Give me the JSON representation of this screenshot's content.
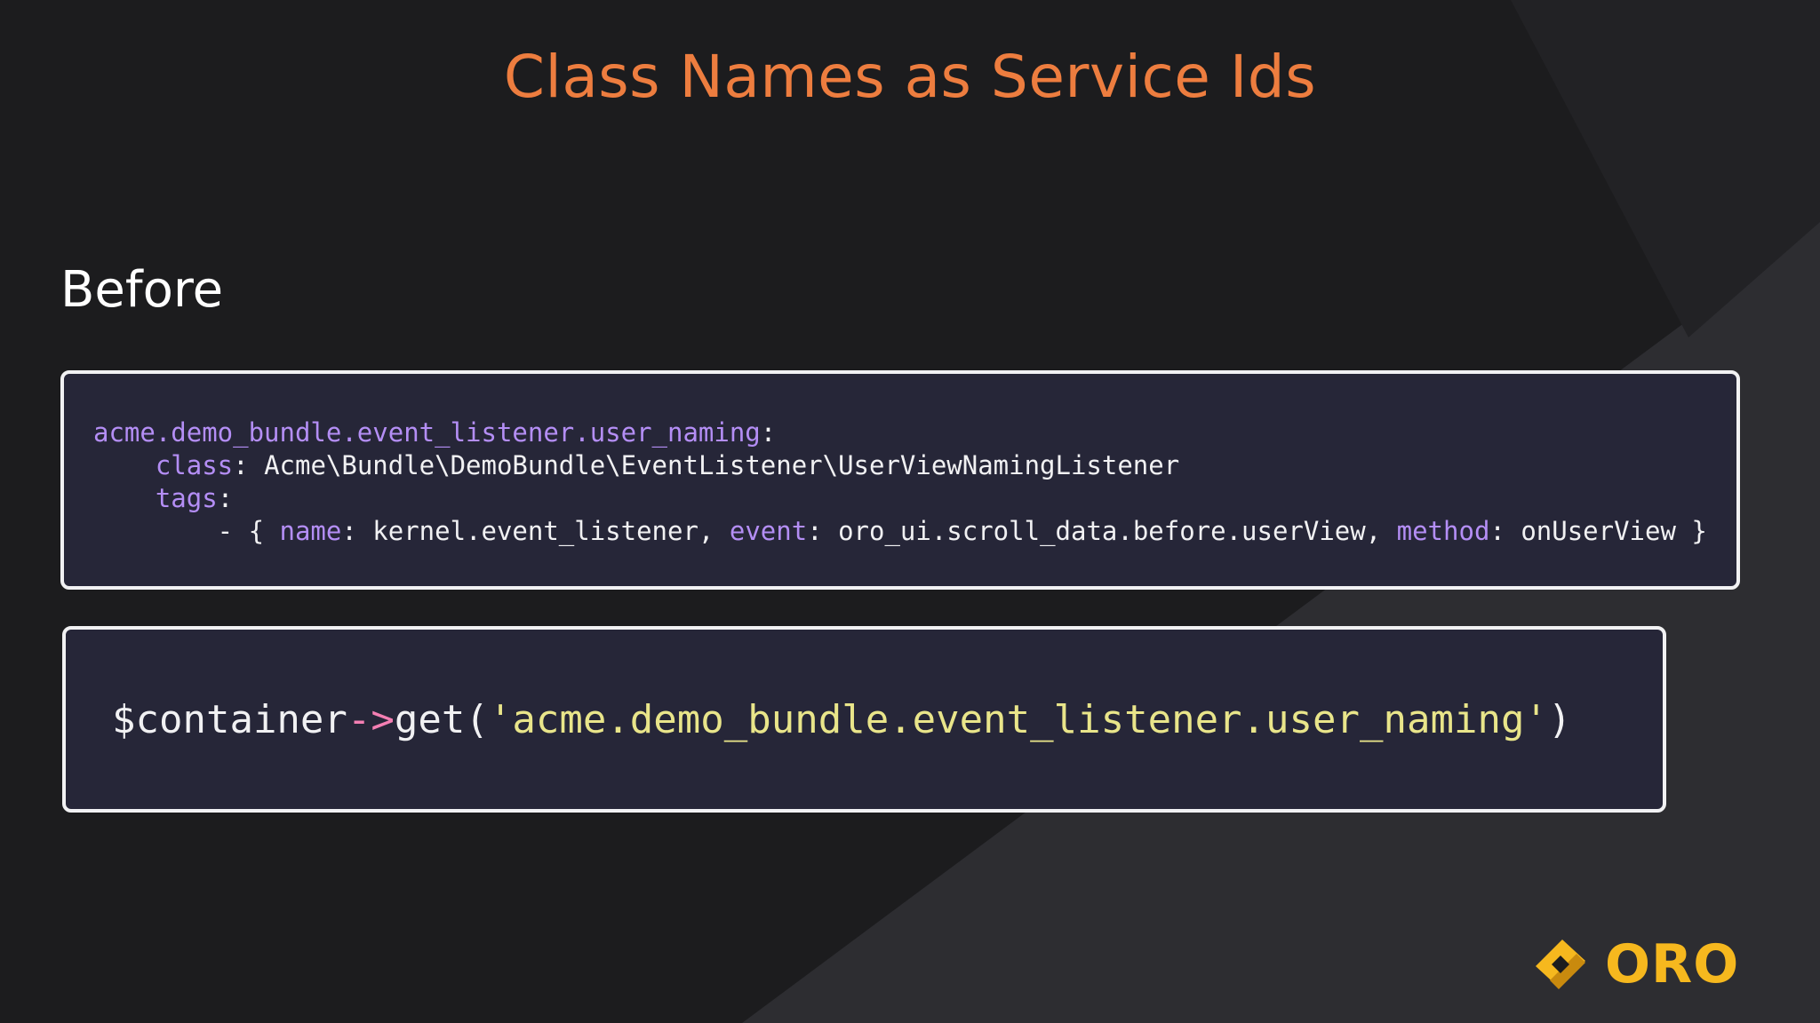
{
  "slide": {
    "title": "Class Names as Service Ids",
    "heading": "Before"
  },
  "code_yaml": {
    "line1_key": "acme.demo_bundle.event_listener.user_naming",
    "line1_colon": ":",
    "line2_indent": "    ",
    "line2_key": "class",
    "line2_rest": ": Acme\\Bundle\\DemoBundle\\EventListener\\UserViewNamingListener",
    "line3_indent": "    ",
    "line3_key": "tags",
    "line3_colon": ":",
    "line4_prefix": "        - { ",
    "line4_key1": "name",
    "line4_val1": ": kernel.event_listener, ",
    "line4_key2": "event",
    "line4_val2": ": oro_ui.scroll_data.before.userView, ",
    "line4_key3": "method",
    "line4_val3": ": onUserView }"
  },
  "code_php": {
    "var": "$container",
    "arrow": "->",
    "call": "get(",
    "string": "'acme.demo_bundle.event_listener.user_naming'",
    "close": ")"
  },
  "logo": {
    "text": "ORO",
    "icon": "oro-logo-icon"
  },
  "colors": {
    "background": "#1c1c1e",
    "title": "#ed7d3f",
    "code_bg": "#262638",
    "yaml_key": "#b48ef5",
    "string": "#e9e58a",
    "arrow": "#f47fb3",
    "logo": "#f6b81e"
  }
}
